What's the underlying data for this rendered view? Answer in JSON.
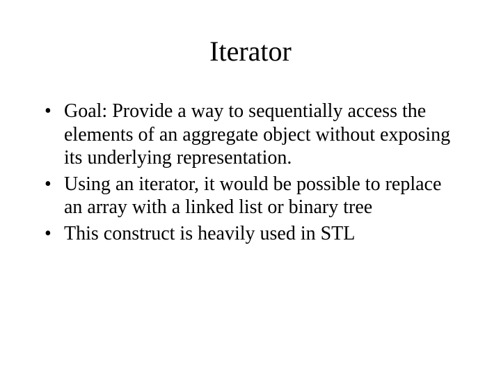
{
  "slide": {
    "title": "Iterator",
    "bullets": [
      "Goal:  Provide a way to sequentially access the elements of an aggregate object without exposing its underlying representation.",
      "Using an iterator, it would be possible to replace an array with a linked list or binary tree",
      "This construct is heavily used in STL"
    ]
  }
}
